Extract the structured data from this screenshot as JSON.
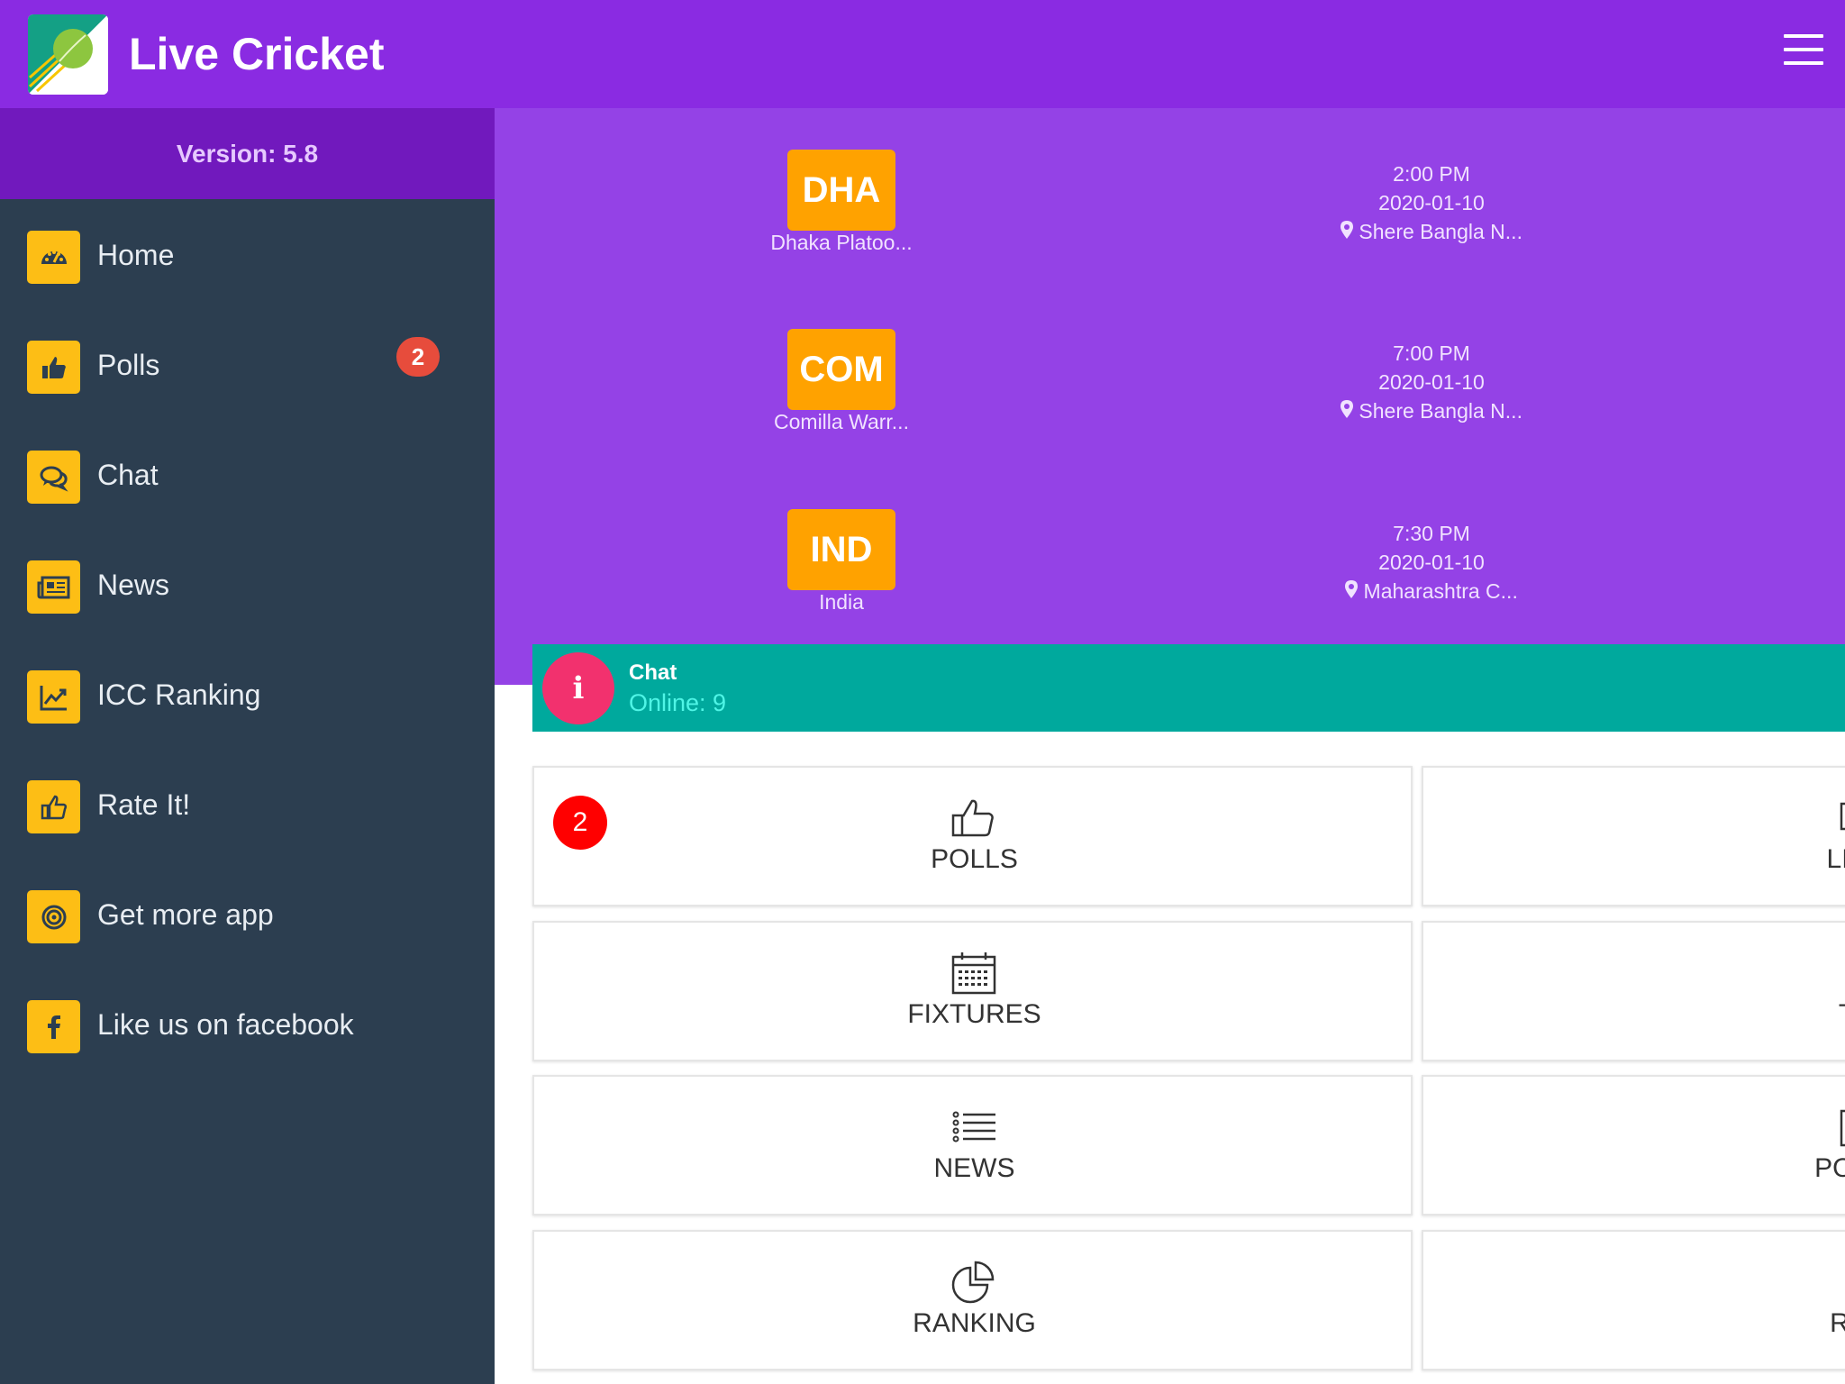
{
  "header": {
    "title": "Live Cricket"
  },
  "sidebar": {
    "version": "Version: 5.8",
    "items": [
      {
        "label": "Home",
        "icon": "dashboard-icon"
      },
      {
        "label": "Polls",
        "icon": "thumbs-up-icon",
        "badge": "2"
      },
      {
        "label": "Chat",
        "icon": "chat-icon"
      },
      {
        "label": "News",
        "icon": "newspaper-icon"
      },
      {
        "label": "ICC Ranking",
        "icon": "line-chart-icon"
      },
      {
        "label": "Rate It!",
        "icon": "thumbs-up-outline-icon"
      },
      {
        "label": "Get more app",
        "icon": "bullseye-icon"
      },
      {
        "label": "Like us on facebook",
        "icon": "facebook-icon"
      }
    ]
  },
  "matches": [
    {
      "code": "DHA",
      "team": "Dhaka Platoo...",
      "time": "2:00 PM",
      "date": "2020-01-10",
      "venue": "Shere Bangla N..."
    },
    {
      "code": "COM",
      "team": "Comilla Warr...",
      "time": "7:00 PM",
      "date": "2020-01-10",
      "venue": "Shere Bangla N..."
    },
    {
      "code": "IND",
      "team": "India",
      "time": "7:30 PM",
      "date": "2020-01-10",
      "venue": "Maharashtra C..."
    }
  ],
  "chat": {
    "title": "Chat",
    "online": "Online: 9",
    "info_glyph": "i"
  },
  "tiles": [
    {
      "label": "POLLS",
      "badge": "2"
    },
    {
      "label": "LIVE"
    },
    {
      "label": "FIXTURES"
    },
    {
      "label": "TE"
    },
    {
      "label": "NEWS"
    },
    {
      "label": "POINT"
    },
    {
      "label": "RANKING"
    },
    {
      "label": "RAT"
    }
  ],
  "colors": {
    "topbar": "#8a2be2",
    "sidebar": "#2c3e50",
    "accent": "#fdbe15",
    "team_box": "#ffa200",
    "chat_banner": "#00a99d",
    "badge": "#e74c3c"
  }
}
